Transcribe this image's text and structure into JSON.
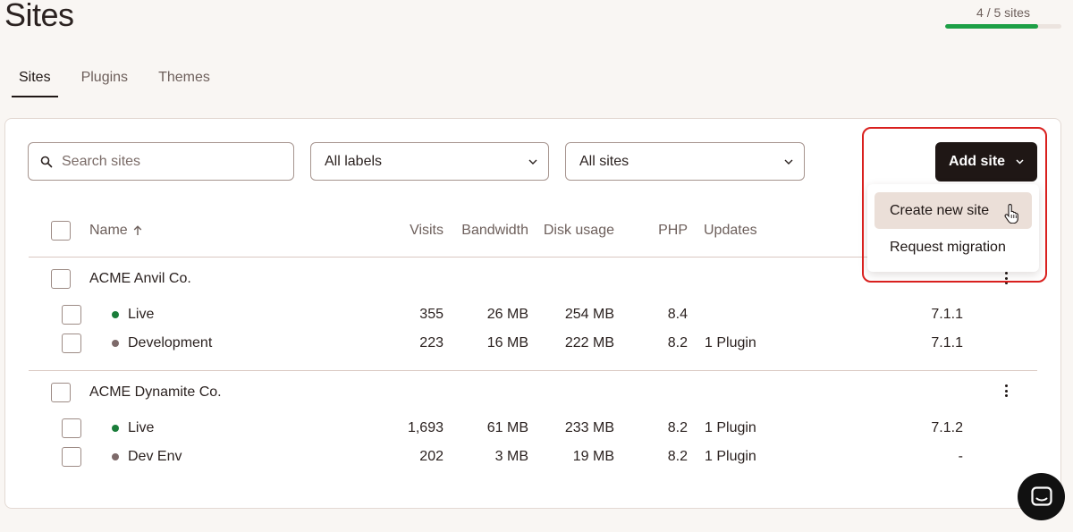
{
  "header": {
    "title": "Sites",
    "usage_label": "4 / 5 sites",
    "usage_fraction": 0.8
  },
  "tabs": [
    {
      "label": "Sites",
      "active": true
    },
    {
      "label": "Plugins",
      "active": false
    },
    {
      "label": "Themes",
      "active": false
    }
  ],
  "toolbar": {
    "search_placeholder": "Search sites",
    "labels_filter": "All labels",
    "sites_filter": "All sites",
    "add_site_label": "Add site"
  },
  "add_site_menu": {
    "items": [
      "Create new site",
      "Request migration"
    ]
  },
  "table": {
    "columns": {
      "name": "Name",
      "visits": "Visits",
      "bandwidth": "Bandwidth",
      "disk_usage": "Disk usage",
      "php": "PHP",
      "updates": "Updates"
    },
    "sites": [
      {
        "name": "ACME Anvil Co.",
        "environments": [
          {
            "env": "Live",
            "status_color": "#1a7d3a",
            "visits": "355",
            "bandwidth": "26 MB",
            "disk": "254 MB",
            "php": "8.4",
            "updates": "",
            "version": "7.1.1"
          },
          {
            "env": "Development",
            "status_color": "#7d6a6a",
            "visits": "223",
            "bandwidth": "16 MB",
            "disk": "222 MB",
            "php": "8.2",
            "updates": "1 Plugin",
            "version": "7.1.1"
          }
        ]
      },
      {
        "name": "ACME Dynamite Co.",
        "environments": [
          {
            "env": "Live",
            "status_color": "#1a7d3a",
            "visits": "1,693",
            "bandwidth": "61 MB",
            "disk": "233 MB",
            "php": "8.2",
            "updates": "1 Plugin",
            "version": "7.1.2"
          },
          {
            "env": "Dev Env",
            "status_color": "#7d6a6a",
            "visits": "202",
            "bandwidth": "3 MB",
            "disk": "19 MB",
            "php": "8.2",
            "updates": "1 Plugin",
            "version": "-"
          }
        ]
      }
    ]
  },
  "colors": {
    "accent_dark": "#1f1715",
    "usage_green": "#1da046",
    "highlight_red": "#d9201e"
  }
}
